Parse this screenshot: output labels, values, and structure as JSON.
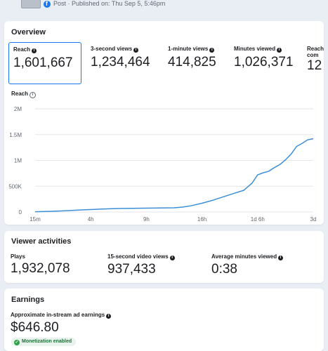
{
  "post_header": {
    "meta": "Post · Published on: Thu Sep 5, 5:46pm"
  },
  "overview": {
    "title": "Overview",
    "metrics": [
      {
        "label": "Reach",
        "value": "1,601,667"
      },
      {
        "label": "3-second views",
        "value": "1,234,464"
      },
      {
        "label": "1-minute views",
        "value": "414,825"
      },
      {
        "label": "Minutes viewed",
        "value": "1,026,371"
      },
      {
        "label": "Reach com",
        "value": "12"
      }
    ],
    "chart_label": "Reach"
  },
  "chart_data": {
    "type": "line",
    "ylabel": "",
    "xlabel": "",
    "y_tick_labels": [
      "0",
      "500K",
      "1M",
      "1.5M",
      "2M"
    ],
    "y_ticks": [
      0,
      500000,
      1000000,
      1500000,
      2000000
    ],
    "ylim": [
      0,
      2000000
    ],
    "x_tick_labels": [
      "15m",
      "4h",
      "9h",
      "16h",
      "1d 6h",
      "3d"
    ],
    "xlim": [
      0,
      1
    ],
    "grid": true,
    "legend": "bottom-center",
    "series": [
      {
        "name": "Reach",
        "color": "#3c8fd6",
        "x": [
          0,
          0.05,
          0.1,
          0.15,
          0.2,
          0.25,
          0.3,
          0.35,
          0.4,
          0.45,
          0.5,
          0.53,
          0.56,
          0.6,
          0.64,
          0.68,
          0.72,
          0.75,
          0.78,
          0.8,
          0.82,
          0.84,
          0.86,
          0.88,
          0.9,
          0.92,
          0.94,
          0.96,
          0.98,
          1.0
        ],
        "y": [
          5000,
          12000,
          22000,
          35000,
          48000,
          60000,
          68000,
          72000,
          75000,
          78000,
          82000,
          95000,
          120000,
          170000,
          230000,
          300000,
          370000,
          420000,
          560000,
          720000,
          760000,
          790000,
          860000,
          920000,
          1010000,
          1120000,
          1270000,
          1330000,
          1400000,
          1420000
        ]
      }
    ]
  },
  "viewer": {
    "title": "Viewer activities",
    "metrics": [
      {
        "label": "Plays",
        "value": "1,932,078"
      },
      {
        "label": "15-second video views",
        "value": "937,433"
      },
      {
        "label": "Average minutes viewed",
        "value": "0:38"
      }
    ]
  },
  "earnings": {
    "title": "Earnings",
    "label": "Approximate in-stream ad earnings",
    "value": "$646.80",
    "badge": "Monetization enabled"
  },
  "colors": {
    "accent": "#1877f2",
    "line": "#3c8fd6",
    "badge_bg": "#e7f3ec",
    "badge_text": "#216e39"
  }
}
